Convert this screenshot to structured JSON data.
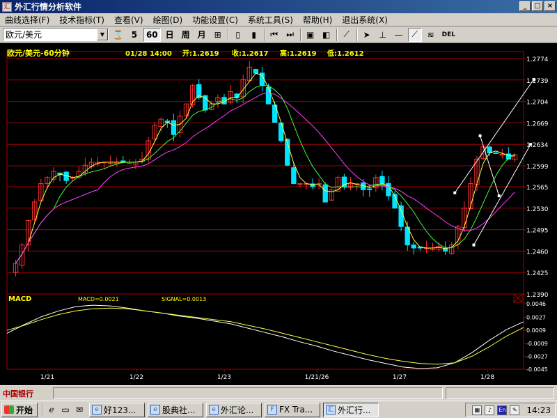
{
  "window": {
    "title": "外汇行情分析软件"
  },
  "menu": [
    "曲线选择(F)",
    "技术指标(T)",
    "查看(V)",
    "绘图(D)",
    "功能设置(C)",
    "系统工具(S)",
    "帮助(H)",
    "退出系统(X)"
  ],
  "toolbar": {
    "symbol": "欧元/美元",
    "period_5": "5",
    "period_60": "60",
    "day": "日",
    "week": "周",
    "month": "月",
    "del": "DEL"
  },
  "chart_header": {
    "name": "欧元/美元-60分钟",
    "datetime": "01/28 14:00",
    "open": "开:1.2619",
    "close": "收:1.2617",
    "high": "高:1.2619",
    "low": "低:1.2612"
  },
  "macd_header": {
    "title": "MACD",
    "macd": "MACD=0.0021",
    "signal": "SIGNAL=0.0013"
  },
  "colors": {
    "grid": "#a00000",
    "up": "#ff3030",
    "down": "#00e5ff",
    "ma1": "#ffff40",
    "ma2": "#40ff40",
    "ma3": "#ff40ff",
    "header": "#ffff00",
    "axis_text": "#ffffff"
  },
  "chart_data": {
    "type": "candlestick",
    "y_ticks": [
      "1.2774",
      "1.2739",
      "1.2704",
      "1.2669",
      "1.2634",
      "1.2599",
      "1.2565",
      "1.2530",
      "1.2495",
      "1.2460",
      "1.2425",
      "1.2390"
    ],
    "ylim": [
      1.239,
      1.2774
    ],
    "x_labels": [
      "1/21",
      "1/22",
      "1/23",
      "1/21/26",
      "1/27",
      "1/28"
    ],
    "close_path": [
      1.244,
      1.247,
      1.251,
      1.254,
      1.257,
      1.258,
      1.259,
      1.2585,
      1.2575,
      1.258,
      1.259,
      1.26,
      1.2605,
      1.2605,
      1.2605,
      1.2605,
      1.2605,
      1.2605,
      1.2605,
      1.2605,
      1.261,
      1.264,
      1.2665,
      1.2675,
      1.267,
      1.265,
      1.268,
      1.27,
      1.273,
      1.271,
      1.269,
      1.27,
      1.271,
      1.27,
      1.272,
      1.271,
      1.274,
      1.276,
      1.275,
      1.273,
      1.27,
      1.267,
      1.264,
      1.26,
      1.257,
      1.257,
      1.257,
      1.2565,
      1.257,
      1.254,
      1.256,
      1.258,
      1.2565,
      1.257,
      1.257,
      1.256,
      1.256,
      1.258,
      1.257,
      1.255,
      1.253,
      1.25,
      1.247,
      1.2465,
      1.2465,
      1.2465,
      1.2465,
      1.2468,
      1.246,
      1.247,
      1.25,
      1.253,
      1.257,
      1.261,
      1.263,
      1.262,
      1.262,
      1.2618,
      1.261,
      1.2617
    ],
    "macd_ticks": [
      "0.0046",
      "0.0027",
      "0.0009",
      "-0.0009",
      "-0.0027",
      "-0.0045"
    ],
    "macd_lim": [
      -0.0045,
      0.0046
    ],
    "macd_path": [
      0.0005,
      0.0017,
      0.0028,
      0.0036,
      0.0042,
      0.0044,
      0.0043,
      0.004,
      0.0036,
      0.0033,
      0.0029,
      0.0026,
      0.0022,
      0.0018,
      0.0012,
      0.0006,
      0.0,
      -0.0007,
      -0.0013,
      -0.002,
      -0.0026,
      -0.0032,
      -0.0037,
      -0.0042,
      -0.0044,
      -0.0043,
      -0.0036,
      -0.0022,
      -0.0005,
      0.001,
      0.0021
    ],
    "signal_path": [
      0.0009,
      0.0016,
      0.0024,
      0.0031,
      0.0036,
      0.0039,
      0.004,
      0.0039,
      0.0036,
      0.0033,
      0.003,
      0.0027,
      0.0024,
      0.0021,
      0.0016,
      0.0011,
      0.0005,
      -0.0001,
      -0.0007,
      -0.0013,
      -0.0019,
      -0.0025,
      -0.003,
      -0.0034,
      -0.0037,
      -0.0038,
      -0.0036,
      -0.0027,
      -0.0014,
      0.0001,
      0.0013
    ]
  },
  "statusbar": {
    "logo": "中国银行"
  },
  "taskbar": {
    "start": "开始",
    "tasks": [
      "好123...",
      "股典社...",
      "外汇论...",
      "FX Tra...",
      "外汇行..."
    ],
    "lang": "En",
    "clock": "14:23"
  }
}
